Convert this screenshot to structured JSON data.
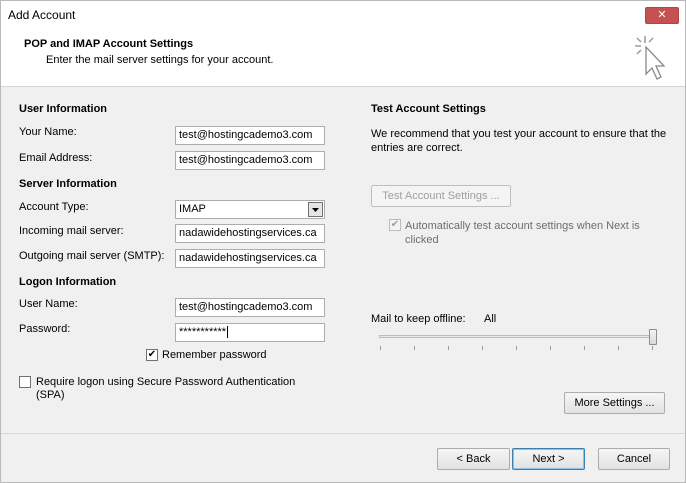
{
  "window": {
    "title": "Add Account",
    "close_label": "✕"
  },
  "header": {
    "title": "POP and IMAP Account Settings",
    "subtitle": "Enter the mail server settings for your account."
  },
  "user_info": {
    "section_title": "User Information",
    "your_name_label": "Your Name:",
    "your_name_value": "test@hostingcademo3.com",
    "email_label": "Email Address:",
    "email_value": "test@hostingcademo3.com"
  },
  "server_info": {
    "section_title": "Server Information",
    "account_type_label": "Account Type:",
    "account_type_value": "IMAP",
    "incoming_label": "Incoming mail server:",
    "incoming_value": "nadawidehostingservices.ca",
    "outgoing_label": "Outgoing mail server (SMTP):",
    "outgoing_value": "nadawidehostingservices.ca"
  },
  "logon_info": {
    "section_title": "Logon Information",
    "username_label": "User Name:",
    "username_value": "test@hostingcademo3.com",
    "password_label": "Password:",
    "password_value": "***********",
    "remember_label": "Remember password",
    "remember_checked": true,
    "spa_label": "Require logon using Secure Password Authentication (SPA)",
    "spa_checked": false
  },
  "test_settings": {
    "section_title": "Test Account Settings",
    "description": "We recommend that you test your account to ensure that the entries are correct.",
    "test_button": "Test Account Settings ...",
    "auto_test_label": "Automatically test account settings when Next is clicked",
    "auto_test_checked": true
  },
  "offline": {
    "label": "Mail to keep offline:",
    "value": "All",
    "slider_level_fraction": 1.0
  },
  "buttons": {
    "more_settings": "More Settings ...",
    "back": "< Back",
    "next": "Next >",
    "cancel": "Cancel"
  },
  "colors": {
    "close_button": "#c75050",
    "default_button_border": "#3c7fb1"
  }
}
